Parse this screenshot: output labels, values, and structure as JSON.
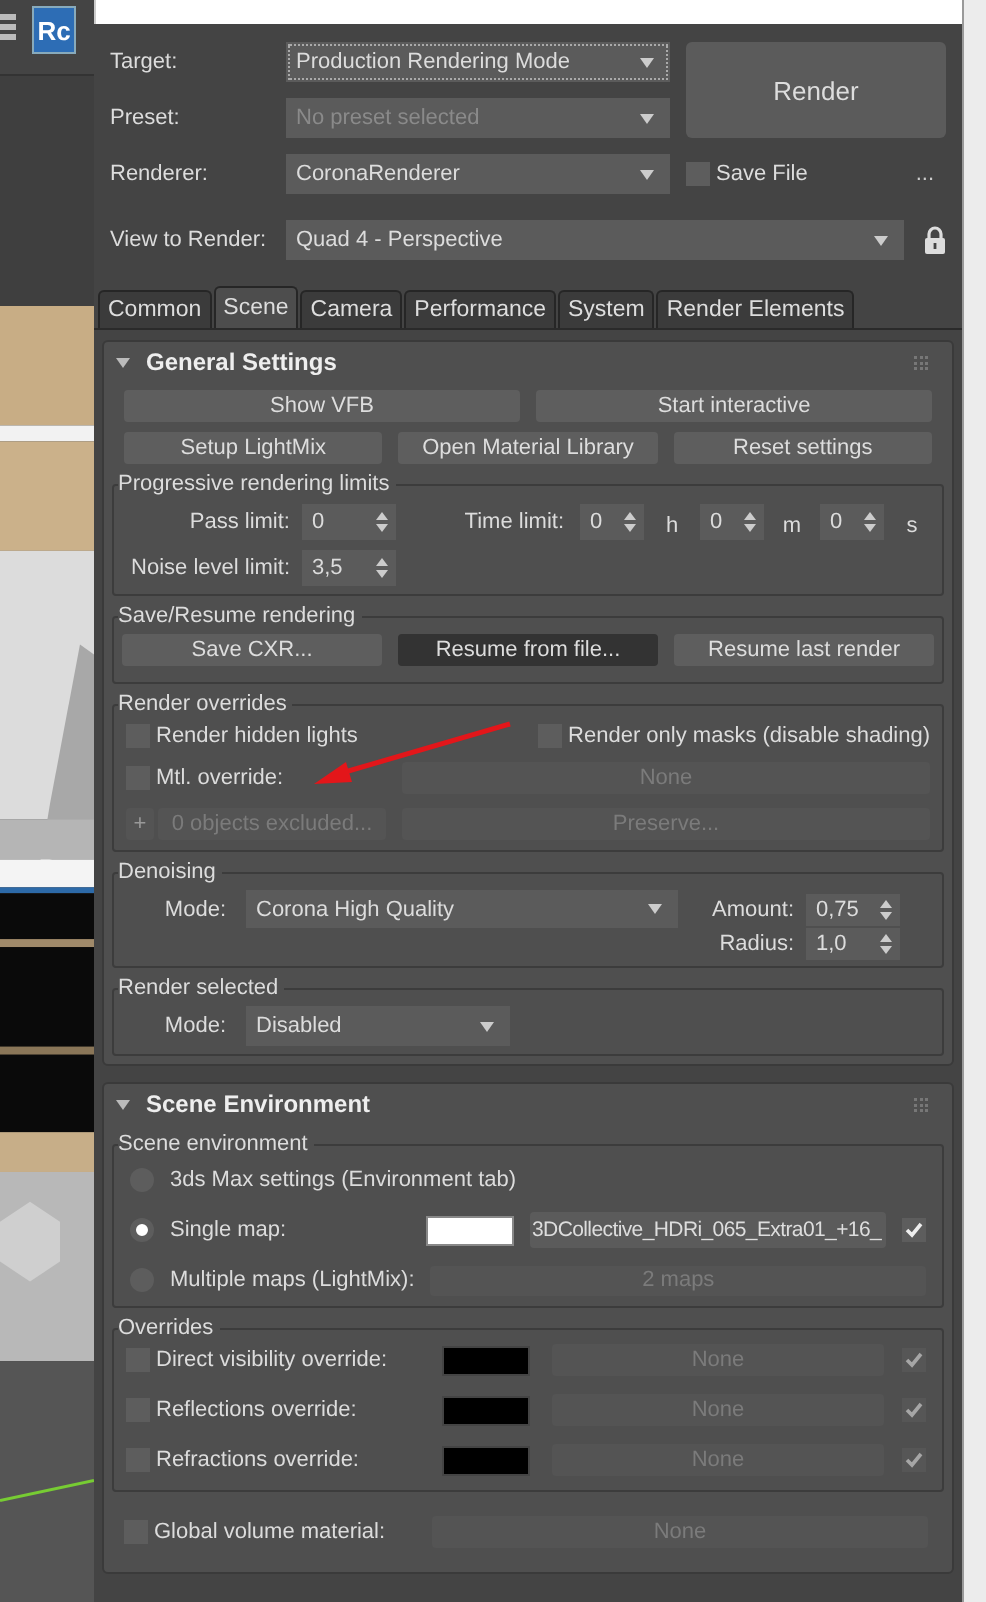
{
  "toolbar": {
    "logo": "Rc"
  },
  "header": {
    "target": {
      "label": "Target:",
      "value": "Production Rendering Mode"
    },
    "preset": {
      "label": "Preset:",
      "placeholder": "No preset selected"
    },
    "renderer": {
      "label": "Renderer:",
      "value": "CoronaRenderer"
    },
    "render_button": "Render",
    "save_file": {
      "label": "Save File",
      "checked": false
    },
    "more_button": "...",
    "view": {
      "label": "View to Render:",
      "value": "Quad 4 - Perspective"
    }
  },
  "tabs": [
    {
      "label": "Common",
      "selected": false
    },
    {
      "label": "Scene",
      "selected": true
    },
    {
      "label": "Camera",
      "selected": false
    },
    {
      "label": "Performance",
      "selected": false
    },
    {
      "label": "System",
      "selected": false
    },
    {
      "label": "Render Elements",
      "selected": false
    }
  ],
  "general_settings": {
    "title": "General Settings",
    "expanded": true,
    "buttons": [
      [
        "Show VFB",
        "Start interactive"
      ],
      [
        "Setup LightMix",
        "Open Material Library",
        "Reset settings"
      ]
    ],
    "progressive": {
      "title": "Progressive rendering limits",
      "pass_label": "Pass limit:",
      "pass_value": "0",
      "time_label": "Time limit:",
      "noise_label": "Noise level limit:",
      "noise_value": "3,5",
      "time": [
        {
          "value": "0",
          "unit": "h"
        },
        {
          "value": "0",
          "unit": "m"
        },
        {
          "value": "0",
          "unit": "s"
        }
      ]
    },
    "save_resume": {
      "title": "Save/Resume rendering",
      "buttons": [
        {
          "label": "Save CXR...",
          "highlighted": false
        },
        {
          "label": "Resume from file...",
          "highlighted": true
        },
        {
          "label": "Resume last render",
          "highlighted": false
        }
      ]
    },
    "overrides": {
      "title": "Render overrides",
      "hidden_lights": {
        "label": "Render hidden lights",
        "checked": false
      },
      "only_masks": {
        "label": "Render only masks (disable shading)",
        "checked": false
      },
      "mtl_override": {
        "label": "Mtl. override:",
        "checked": false,
        "material": "None"
      },
      "exclude": {
        "icon": "+",
        "label": "0 objects excluded..."
      },
      "preserve": "Preserve..."
    },
    "denoising": {
      "title": "Denoising",
      "mode_label": "Mode:",
      "mode": "Corona High Quality",
      "amount_label": "Amount:",
      "amount": "0,75",
      "radius_label": "Radius:",
      "radius": "1,0"
    },
    "render_selected": {
      "title": "Render selected",
      "mode_label": "Mode:",
      "mode": "Disabled"
    }
  },
  "scene_environment": {
    "title": "Scene Environment",
    "expanded": true,
    "environment": {
      "title": "Scene environment",
      "options": [
        {
          "kind": "plain",
          "label": "3ds Max settings (Environment tab)",
          "selected": false
        },
        {
          "kind": "map",
          "label": "Single map:",
          "selected": true,
          "color": "#ffffff",
          "map": "3DCollective_HDRi_065_Extra01_+16_",
          "map_enabled": true
        },
        {
          "kind": "lightmix",
          "label": "Multiple maps (LightMix):",
          "selected": false,
          "maps": "2 maps"
        }
      ]
    },
    "overrides": {
      "title": "Overrides",
      "items": [
        {
          "label": "Direct visibility override:",
          "checked": false,
          "color": "#000000",
          "map": "None",
          "map_enabled": true
        },
        {
          "label": "Reflections override:",
          "checked": false,
          "color": "#000000",
          "map": "None",
          "map_enabled": true
        },
        {
          "label": "Refractions override:",
          "checked": false,
          "color": "#000000",
          "map": "None",
          "map_enabled": true
        }
      ]
    },
    "global_volume": {
      "label": "Global volume material:",
      "checked": false,
      "material": "None"
    }
  }
}
